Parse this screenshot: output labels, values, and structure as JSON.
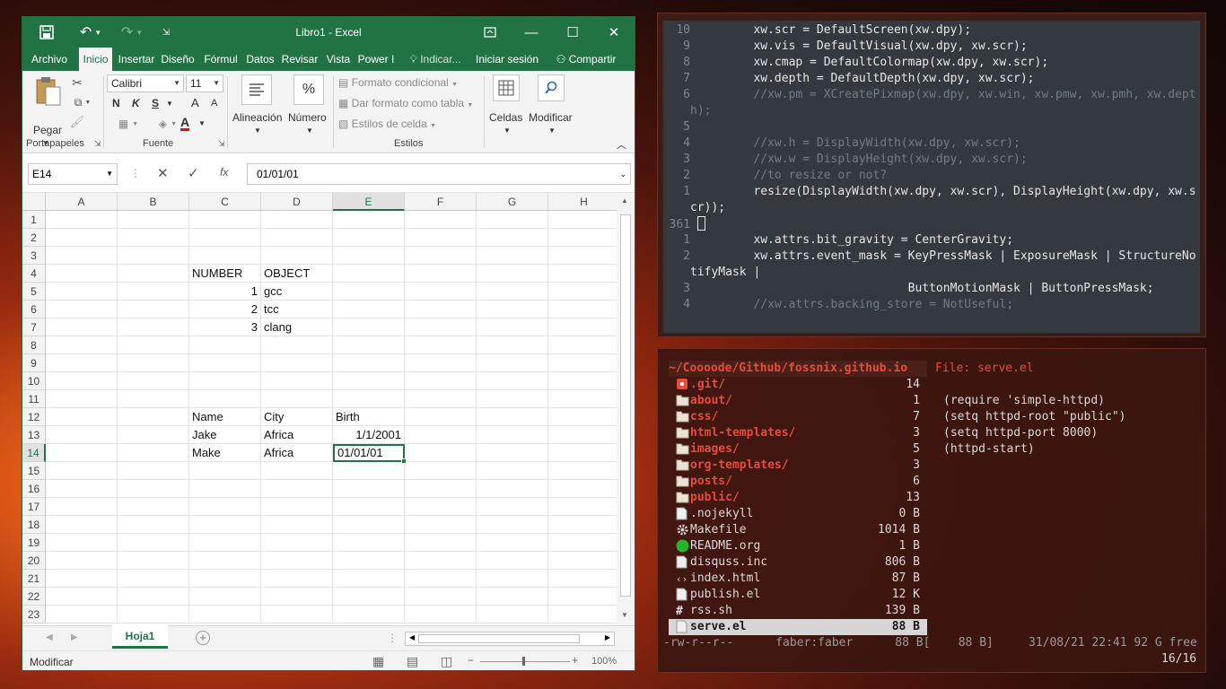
{
  "excel": {
    "title": "Libro1 - Excel",
    "tabs": [
      "Archivo",
      "Inicio",
      "Insertar",
      "Diseño",
      "Fórmul",
      "Datos",
      "Revisar",
      "Vista",
      "Power I",
      "Indicar...",
      "Iniciar sesión",
      "Compartir"
    ],
    "active_tab": "Inicio",
    "ribbon": {
      "paste_label": "Pegar",
      "clipboard_group": "Portapapeles",
      "font_name": "Calibri",
      "font_size": "11",
      "bold": "N",
      "italic": "K",
      "strike": "S",
      "grow": "A",
      "shrink": "A",
      "font_color": "A",
      "font_group": "Fuente",
      "align_label": "Alineación",
      "number_label": "Número",
      "percent": "%",
      "cond_format": "Formato condicional",
      "table_format": "Dar formato como tabla",
      "cell_styles": "Estilos de celda",
      "styles_group": "Estilos",
      "cells_label": "Celdas",
      "modify_label": "Modificar"
    },
    "namebox": "E14",
    "fx": "fx",
    "formula": "01/01/01",
    "columns": [
      "A",
      "B",
      "C",
      "D",
      "E",
      "F",
      "G",
      "H"
    ],
    "selected_column": "E",
    "rows": [
      "1",
      "2",
      "3",
      "4",
      "5",
      "6",
      "7",
      "8",
      "9",
      "10",
      "11",
      "12",
      "13",
      "14",
      "15",
      "16",
      "17",
      "18",
      "19",
      "20",
      "21",
      "22",
      "23"
    ],
    "selected_row": "14",
    "cells": {
      "C4": "NUMBER",
      "D4": "OBJECT",
      "C5": "1",
      "D5": "gcc",
      "C6": "2",
      "D6": "tcc",
      "C7": "3",
      "D7": "clang",
      "C12": "Name",
      "D12": "City",
      "E12": "Birth",
      "C13": "Jake",
      "D13": "Africa",
      "E13": "1/1/2001",
      "C14": "Make",
      "D14": "Africa",
      "E14": "01/01/01"
    },
    "sheet_tab": "Hoja1",
    "status_text": "Modificar",
    "zoom": "100%"
  },
  "code": {
    "lines": [
      {
        "n": "10",
        "t": "        xw.scr = DefaultScreen(xw.dpy);",
        "c": false
      },
      {
        "n": "9",
        "t": "        xw.vis = DefaultVisual(xw.dpy, xw.scr);",
        "c": false
      },
      {
        "n": "8",
        "t": "        xw.cmap = DefaultColormap(xw.dpy, xw.scr);",
        "c": false
      },
      {
        "n": "7",
        "t": "        xw.depth = DefaultDepth(xw.dpy, xw.scr);",
        "c": false
      },
      {
        "n": "6",
        "t": "        //xw.pm = XCreatePixmap(xw.dpy, xw.win, xw.pmw, xw.pmh, xw.dept",
        "c": true
      },
      {
        "n": "",
        "t": "h);",
        "c": true
      },
      {
        "n": "5",
        "t": "",
        "c": false
      },
      {
        "n": "4",
        "t": "        //xw.h = DisplayWidth(xw.dpy, xw.scr);",
        "c": true
      },
      {
        "n": "3",
        "t": "        //xw.w = DisplayHeight(xw.dpy, xw.scr);",
        "c": true
      },
      {
        "n": "2",
        "t": "        //to resize or not?",
        "c": true
      },
      {
        "n": "1",
        "t": "        resize(DisplayWidth(xw.dpy, xw.scr), DisplayHeight(xw.dpy, xw.s",
        "c": false
      },
      {
        "n": "",
        "t": "cr));",
        "c": false
      },
      {
        "n": "361",
        "t": "",
        "c": false,
        "cursor": true
      },
      {
        "n": "1",
        "t": "        xw.attrs.bit_gravity = CenterGravity;",
        "c": false
      },
      {
        "n": "2",
        "t": "        xw.attrs.event_mask = KeyPressMask | ExposureMask | StructureNo",
        "c": false
      },
      {
        "n": "",
        "t": "tifyMask |",
        "c": false
      },
      {
        "n": "3",
        "t": "                              ButtonMotionMask | ButtonPressMask;",
        "c": false
      },
      {
        "n": "4",
        "t": "        //xw.attrs.backing_store = NotUseful;",
        "c": true
      }
    ]
  },
  "filemanager": {
    "path": "~/Coooode/Github/fossnix.github.io",
    "preview_title": "File: serve.el",
    "entries": [
      {
        "name": ".git/",
        "size": "14",
        "type": "dir",
        "icon": "git-icon"
      },
      {
        "name": "about/",
        "size": "1",
        "type": "dir",
        "icon": "folder-icon"
      },
      {
        "name": "css/",
        "size": "7",
        "type": "dir",
        "icon": "folder-icon"
      },
      {
        "name": "html-templates/",
        "size": "3",
        "type": "dir",
        "icon": "folder-icon"
      },
      {
        "name": "images/",
        "size": "5",
        "type": "dir",
        "icon": "folder-icon"
      },
      {
        "name": "org-templates/",
        "size": "3",
        "type": "dir",
        "icon": "folder-icon"
      },
      {
        "name": "posts/",
        "size": "6",
        "type": "dir",
        "icon": "folder-icon"
      },
      {
        "name": "public/",
        "size": "13",
        "type": "dir",
        "icon": "folder-icon"
      },
      {
        "name": ".nojekyll",
        "size": "0 B",
        "type": "file",
        "icon": "file-icon"
      },
      {
        "name": "Makefile",
        "size": "1014 B",
        "type": "file",
        "icon": "gear-icon"
      },
      {
        "name": "README.org",
        "size": "1 B",
        "type": "file",
        "icon": "green-circle-icon"
      },
      {
        "name": "disquss.inc",
        "size": "806 B",
        "type": "file",
        "icon": "file-icon"
      },
      {
        "name": "index.html",
        "size": "87 B",
        "type": "file",
        "icon": "code-icon"
      },
      {
        "name": "publish.el",
        "size": "12 K",
        "type": "file",
        "icon": "file-icon"
      },
      {
        "name": "rss.sh",
        "size": "139 B",
        "type": "file",
        "icon": "hash-icon"
      },
      {
        "name": "serve.el",
        "size": "88 B",
        "type": "file",
        "icon": "file-icon",
        "selected": true
      }
    ],
    "preview_lines": [
      "(require 'simple-httpd)",
      "(setq httpd-root \"public\")",
      "(setq httpd-port 8000)",
      "(httpd-start)"
    ],
    "status_line": "-rw-r--r--      faber:faber      88 B[    88 B]     31/08/21 22:41 92 G free",
    "position": "16/16"
  }
}
